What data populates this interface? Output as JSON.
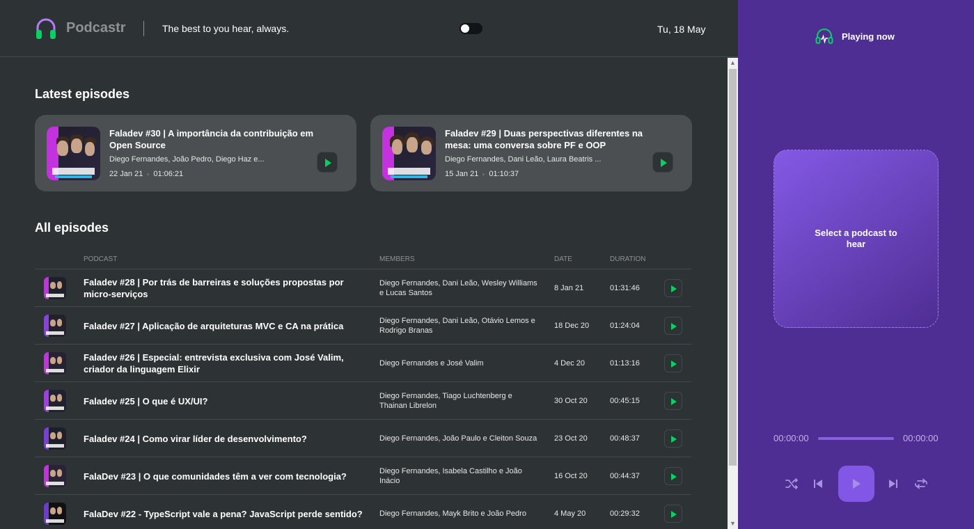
{
  "header": {
    "logo_text": "Podcastr",
    "tagline": "The best to you hear, always.",
    "date": "Tu, 18 May"
  },
  "latest": {
    "title": "Latest episodes",
    "cards": [
      {
        "title": "Faladev #30 | A importância da contribuição em Open Source",
        "members": "Diego Fernandes, João Pedro, Diego Haz e...",
        "date": "22 Jan 21",
        "duration": "01:06:21"
      },
      {
        "title": "Faladev #29 | Duas perspectivas diferentes na mesa: uma conversa sobre PF e OOP",
        "members": "Diego Fernandes, Dani Leão, Laura Beatris ...",
        "date": "15 Jan 21",
        "duration": "01:10:37"
      }
    ]
  },
  "all": {
    "title": "All episodes",
    "headers": {
      "podcast": "PODCAST",
      "members": "MEMBERS",
      "date": "DATE",
      "duration": "DURATION"
    },
    "rows": [
      {
        "title": "Faladev #28 | Por trás de barreiras e soluções propostas por micro-serviços",
        "members": "Diego Fernandes, Dani Leão, Wesley Williams e Lucas Santos",
        "date": "8 Jan 21",
        "duration": "01:31:46"
      },
      {
        "title": "Faladev #27 | Aplicação de arquiteturas MVC e CA na prática",
        "members": "Diego Fernandes, Dani Leão, Otávio Lemos e Rodrigo Branas",
        "date": "18 Dec 20",
        "duration": "01:24:04"
      },
      {
        "title": "Faladev #26 | Especial: entrevista exclusiva com José Valim, criador da linguagem Elixir",
        "members": "Diego Fernandes e José Valim",
        "date": "4 Dec 20",
        "duration": "01:13:16"
      },
      {
        "title": "Faladev #25 | O que é UX/UI?",
        "members": "Diego Fernandes, Tiago Luchtenberg e Thainan Librelon",
        "date": "30 Oct 20",
        "duration": "00:45:15"
      },
      {
        "title": "Faladev #24 | Como virar líder de desenvolvimento?",
        "members": "Diego Fernandes, João Paulo e Cleiton Souza",
        "date": "23 Oct 20",
        "duration": "00:48:37"
      },
      {
        "title": "FalaDev #23 | O que comunidades têm a ver com tecnologia?",
        "members": "Diego Fernandes, Isabela Castilho e João Inácio",
        "date": "16 Oct 20",
        "duration": "00:44:37"
      },
      {
        "title": "FalaDev #22 - TypeScript vale a pena? JavaScript perde sentido?",
        "members": "Diego Fernandes, Mayk Brito e João Pedro",
        "date": "4 May 20",
        "duration": "00:29:32"
      }
    ]
  },
  "player": {
    "heading": "Playing now",
    "empty_text": "Select a podcast to hear",
    "time_current": "00:00:00",
    "time_total": "00:00:00",
    "icons": [
      "shuffle-icon",
      "skip-previous-icon",
      "play-icon",
      "skip-next-icon",
      "repeat-icon"
    ]
  },
  "colors": {
    "background": "#2d3234",
    "card": "#4b4f51",
    "accent_green": "#04d361",
    "player_purple": "#4f2e93",
    "play_button": "#8257e5"
  }
}
